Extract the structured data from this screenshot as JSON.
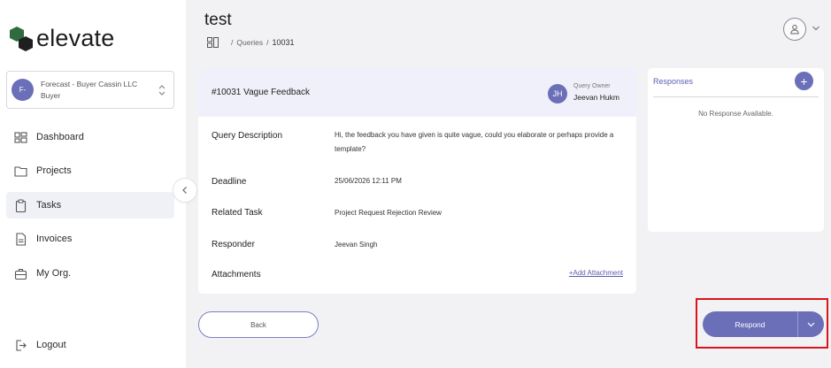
{
  "app": {
    "logo_text": "elevate"
  },
  "org_selector": {
    "avatar": "F-",
    "name": "Forecast - Buyer Cassin LLC",
    "role": "Buyer"
  },
  "sidebar": {
    "items": [
      {
        "label": "Dashboard",
        "icon": "dashboard-icon"
      },
      {
        "label": "Projects",
        "icon": "folder-icon"
      },
      {
        "label": "Tasks",
        "icon": "clipboard-icon",
        "active": true
      },
      {
        "label": "Invoices",
        "icon": "invoice-icon"
      },
      {
        "label": "My Org.",
        "icon": "briefcase-icon"
      }
    ],
    "logout_label": "Logout"
  },
  "header": {
    "title": "test",
    "breadcrumb": {
      "items": [
        "Queries",
        "10031"
      ]
    }
  },
  "query": {
    "title": "#10031 Vague Feedback",
    "owner_initials": "JH",
    "owner_label": "Query Owner",
    "owner_name": "Jeevan Hukm",
    "fields": {
      "description_label": "Query Description",
      "description_value": "Hi, the feedback you have given is quite vague, could you elaborate or perhaps provide a template?",
      "deadline_label": "Deadline",
      "deadline_value": "25/06/2026 12:11 PM",
      "related_label": "Related Task",
      "related_value": "Project Request Rejection Review",
      "responder_label": "Responder",
      "responder_value": "Jeevan Singh",
      "attachments_label": "Attachments",
      "add_attachment": "+Add Attachment"
    }
  },
  "responses": {
    "title": "Responses",
    "add": "+",
    "empty": "No Response Available."
  },
  "actions": {
    "back": "Back",
    "respond": "Respond"
  },
  "colors": {
    "accent": "#6a6fb8",
    "highlight": "#d9141b"
  }
}
